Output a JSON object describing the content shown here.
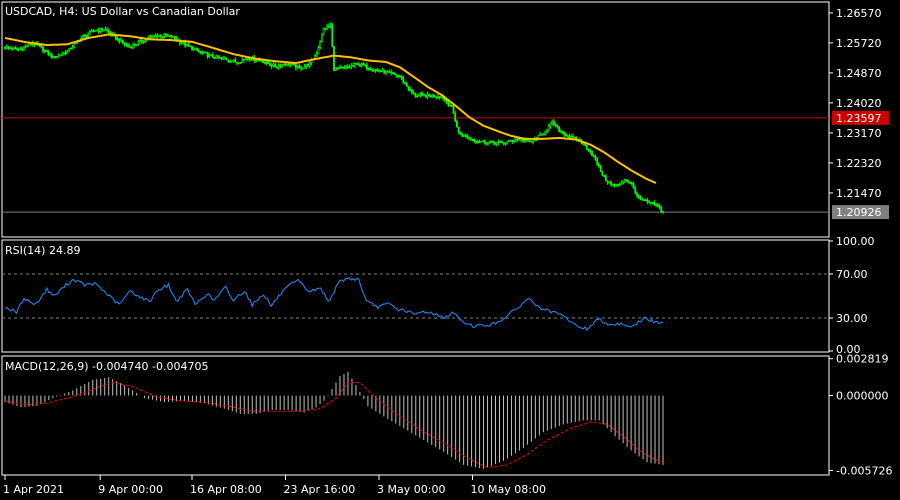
{
  "window": {
    "symbol_title": "USDCAD, H4:  US Dollar vs Canadian Dollar"
  },
  "colors": {
    "background": "#000000",
    "text": "#ffffff",
    "frame": "#ffffff",
    "candle": "#00ff00",
    "ma": "#ffc000",
    "rsi": "#1e90ff",
    "macd_hist": "#c0c0c0",
    "macd_signal": "#ff0000",
    "level_line": "#cc0000",
    "level_badge": "#cc0000",
    "bid_line": "#808080",
    "bid_badge": "#808080",
    "grid_dash": "#808080"
  },
  "chart_data": [
    {
      "type": "candlestick",
      "name": "price",
      "ylim": [
        1.2025,
        1.2685
      ],
      "yticks": [
        "1.26570",
        "1.25720",
        "1.24870",
        "1.24020",
        "1.23170",
        "1.22320",
        "1.21470"
      ],
      "level_line": {
        "value": 1.23597,
        "label": "1.23597"
      },
      "bid_line": {
        "value": 1.20926,
        "label": "1.20926"
      },
      "close_waypoints": [
        [
          0,
          1.256
        ],
        [
          8,
          1.2552
        ],
        [
          16,
          1.2572
        ],
        [
          20,
          1.256
        ],
        [
          28,
          1.253
        ],
        [
          36,
          1.2548
        ],
        [
          44,
          1.2586
        ],
        [
          52,
          1.2608
        ],
        [
          58,
          1.261
        ],
        [
          64,
          1.2585
        ],
        [
          72,
          1.256
        ],
        [
          80,
          1.258
        ],
        [
          88,
          1.2594
        ],
        [
          96,
          1.259
        ],
        [
          104,
          1.2567
        ],
        [
          112,
          1.2547
        ],
        [
          120,
          1.2532
        ],
        [
          128,
          1.2525
        ],
        [
          134,
          1.2517
        ],
        [
          140,
          1.253
        ],
        [
          148,
          1.2522
        ],
        [
          156,
          1.2505
        ],
        [
          163,
          1.2515
        ],
        [
          170,
          1.25
        ],
        [
          176,
          1.2512
        ],
        [
          180,
          1.2544
        ],
        [
          184,
          1.2612
        ],
        [
          188,
          1.2622
        ],
        [
          190,
          1.2498
        ],
        [
          196,
          1.25
        ],
        [
          204,
          1.2513
        ],
        [
          212,
          1.2498
        ],
        [
          220,
          1.2488
        ],
        [
          228,
          1.2477
        ],
        [
          236,
          1.2424
        ],
        [
          244,
          1.2422
        ],
        [
          252,
          1.2422
        ],
        [
          258,
          1.239
        ],
        [
          262,
          1.2315
        ],
        [
          272,
          1.2295
        ],
        [
          280,
          1.229
        ],
        [
          288,
          1.2288
        ],
        [
          296,
          1.23
        ],
        [
          304,
          1.2292
        ],
        [
          310,
          1.2312
        ],
        [
          316,
          1.2346
        ],
        [
          320,
          1.2325
        ],
        [
          326,
          1.2305
        ],
        [
          332,
          1.2295
        ],
        [
          338,
          1.2265
        ],
        [
          342,
          1.223
        ],
        [
          346,
          1.219
        ],
        [
          350,
          1.217
        ],
        [
          354,
          1.2168
        ],
        [
          358,
          1.2185
        ],
        [
          362,
          1.217
        ],
        [
          366,
          1.213
        ],
        [
          370,
          1.2122
        ],
        [
          376,
          1.2112
        ],
        [
          380,
          1.2093
        ]
      ],
      "ma_waypoints": [
        [
          0,
          1.2586
        ],
        [
          12,
          1.2574
        ],
        [
          24,
          1.2566
        ],
        [
          36,
          1.2568
        ],
        [
          48,
          1.2586
        ],
        [
          60,
          1.2596
        ],
        [
          72,
          1.2591
        ],
        [
          84,
          1.2582
        ],
        [
          96,
          1.258
        ],
        [
          108,
          1.2575
        ],
        [
          120,
          1.2558
        ],
        [
          132,
          1.254
        ],
        [
          144,
          1.2528
        ],
        [
          156,
          1.252
        ],
        [
          168,
          1.2515
        ],
        [
          180,
          1.2527
        ],
        [
          190,
          1.2536
        ],
        [
          200,
          1.2531
        ],
        [
          210,
          1.2522
        ],
        [
          220,
          1.2518
        ],
        [
          228,
          1.2503
        ],
        [
          236,
          1.2476
        ],
        [
          244,
          1.2448
        ],
        [
          252,
          1.2425
        ],
        [
          260,
          1.2395
        ],
        [
          268,
          1.2362
        ],
        [
          276,
          1.2338
        ],
        [
          284,
          1.2323
        ],
        [
          292,
          1.2309
        ],
        [
          300,
          1.23
        ],
        [
          310,
          1.23
        ],
        [
          320,
          1.2303
        ],
        [
          330,
          1.2298
        ],
        [
          338,
          1.2284
        ],
        [
          346,
          1.2262
        ],
        [
          354,
          1.2235
        ],
        [
          362,
          1.221
        ],
        [
          370,
          1.2188
        ],
        [
          376,
          1.2175
        ]
      ],
      "x_tick_labels": [
        "1 Apr 2021",
        "9 Apr 00:00",
        "16 Apr 08:00",
        "23 Apr 16:00",
        "3 May 00:00",
        "10 May 08:00"
      ],
      "x_tick_bar_index": [
        0,
        55,
        108,
        162,
        216,
        270
      ]
    },
    {
      "type": "line",
      "name": "RSI(14)",
      "header": "RSI(14) 24.89",
      "ylim": [
        0,
        100
      ],
      "yticks": [
        "100.00",
        "70.00",
        "30.00",
        "0.00"
      ],
      "levels": [
        70,
        30
      ],
      "waypoints": [
        [
          0,
          40
        ],
        [
          6,
          35
        ],
        [
          10,
          48
        ],
        [
          16,
          42
        ],
        [
          22,
          56
        ],
        [
          26,
          50
        ],
        [
          32,
          60
        ],
        [
          36,
          65
        ],
        [
          42,
          60
        ],
        [
          48,
          61
        ],
        [
          56,
          48
        ],
        [
          60,
          42
        ],
        [
          66,
          55
        ],
        [
          70,
          50
        ],
        [
          76,
          45
        ],
        [
          80,
          55
        ],
        [
          86,
          60
        ],
        [
          90,
          45
        ],
        [
          96,
          56
        ],
        [
          100,
          42
        ],
        [
          106,
          52
        ],
        [
          110,
          46
        ],
        [
          116,
          58
        ],
        [
          120,
          46
        ],
        [
          126,
          55
        ],
        [
          130,
          42
        ],
        [
          136,
          52
        ],
        [
          140,
          41
        ],
        [
          146,
          54
        ],
        [
          150,
          60
        ],
        [
          154,
          64
        ],
        [
          160,
          54
        ],
        [
          166,
          57
        ],
        [
          170,
          45
        ],
        [
          176,
          63
        ],
        [
          180,
          66
        ],
        [
          186,
          65
        ],
        [
          190,
          45
        ],
        [
          196,
          40
        ],
        [
          202,
          43
        ],
        [
          206,
          38
        ],
        [
          210,
          37
        ],
        [
          216,
          33
        ],
        [
          220,
          36
        ],
        [
          226,
          34
        ],
        [
          230,
          30
        ],
        [
          236,
          35
        ],
        [
          240,
          27
        ],
        [
          246,
          23
        ],
        [
          252,
          23
        ],
        [
          258,
          25
        ],
        [
          264,
          32
        ],
        [
          268,
          37
        ],
        [
          272,
          43
        ],
        [
          276,
          48
        ],
        [
          280,
          40
        ],
        [
          286,
          36
        ],
        [
          292,
          33
        ],
        [
          296,
          29
        ],
        [
          300,
          23
        ],
        [
          306,
          20
        ],
        [
          312,
          29
        ],
        [
          318,
          24
        ],
        [
          324,
          25
        ],
        [
          330,
          22
        ],
        [
          336,
          30
        ],
        [
          342,
          26
        ],
        [
          346,
          24.89
        ]
      ]
    },
    {
      "type": "bar+line",
      "name": "MACD(12,26,9)",
      "header": "MACD(12,26,9) -0.004740 -0.004705",
      "ylim": [
        -0.006,
        0.00295
      ],
      "yticks": [
        "0.002819",
        "0.000000",
        "-0.005726"
      ],
      "hist_waypoints": [
        [
          0,
          -0.0005
        ],
        [
          8,
          -0.0009
        ],
        [
          16,
          -0.0008
        ],
        [
          24,
          -0.0002
        ],
        [
          34,
          0.0004
        ],
        [
          44,
          0.0012
        ],
        [
          52,
          0.0014
        ],
        [
          60,
          0.0008
        ],
        [
          70,
          -0.0002
        ],
        [
          80,
          -0.0005
        ],
        [
          90,
          -0.0004
        ],
        [
          100,
          -0.0006
        ],
        [
          110,
          -0.001
        ],
        [
          118,
          -0.0014
        ],
        [
          126,
          -0.0014
        ],
        [
          134,
          -0.0011
        ],
        [
          142,
          -0.0011
        ],
        [
          150,
          -0.0013
        ],
        [
          156,
          -0.0009
        ],
        [
          160,
          -0.0004
        ],
        [
          164,
          0.0005
        ],
        [
          168,
          0.0015
        ],
        [
          172,
          0.0018
        ],
        [
          176,
          0.0008
        ],
        [
          182,
          -0.0008
        ],
        [
          190,
          -0.0016
        ],
        [
          200,
          -0.0025
        ],
        [
          210,
          -0.0034
        ],
        [
          220,
          -0.0043
        ],
        [
          230,
          -0.0053
        ],
        [
          240,
          -0.0056
        ],
        [
          250,
          -0.005
        ],
        [
          260,
          -0.004
        ],
        [
          270,
          -0.0028
        ],
        [
          280,
          -0.0022
        ],
        [
          290,
          -0.0019
        ],
        [
          298,
          -0.0019
        ],
        [
          306,
          -0.0031
        ],
        [
          314,
          -0.0042
        ],
        [
          322,
          -0.0051
        ],
        [
          330,
          -0.0053
        ]
      ],
      "signal_waypoints": [
        [
          0,
          -0.0004
        ],
        [
          10,
          -0.0007
        ],
        [
          20,
          -0.0006
        ],
        [
          34,
          -0.0001
        ],
        [
          46,
          0.0006
        ],
        [
          54,
          0.001
        ],
        [
          64,
          0.0007
        ],
        [
          76,
          -0.0001
        ],
        [
          88,
          -0.0004
        ],
        [
          100,
          -0.0005
        ],
        [
          112,
          -0.0008
        ],
        [
          124,
          -0.0012
        ],
        [
          136,
          -0.0012
        ],
        [
          148,
          -0.0012
        ],
        [
          158,
          -0.001
        ],
        [
          166,
          -0.0002
        ],
        [
          172,
          0.001
        ],
        [
          178,
          0.001
        ],
        [
          186,
          -0.0002
        ],
        [
          196,
          -0.0014
        ],
        [
          208,
          -0.0026
        ],
        [
          220,
          -0.0036
        ],
        [
          232,
          -0.0048
        ],
        [
          242,
          -0.0055
        ],
        [
          252,
          -0.0053
        ],
        [
          262,
          -0.0045
        ],
        [
          272,
          -0.0034
        ],
        [
          284,
          -0.0025
        ],
        [
          294,
          -0.002
        ],
        [
          302,
          -0.0022
        ],
        [
          310,
          -0.0031
        ],
        [
          318,
          -0.0042
        ],
        [
          326,
          -0.0049
        ],
        [
          330,
          -0.0051
        ]
      ]
    }
  ]
}
